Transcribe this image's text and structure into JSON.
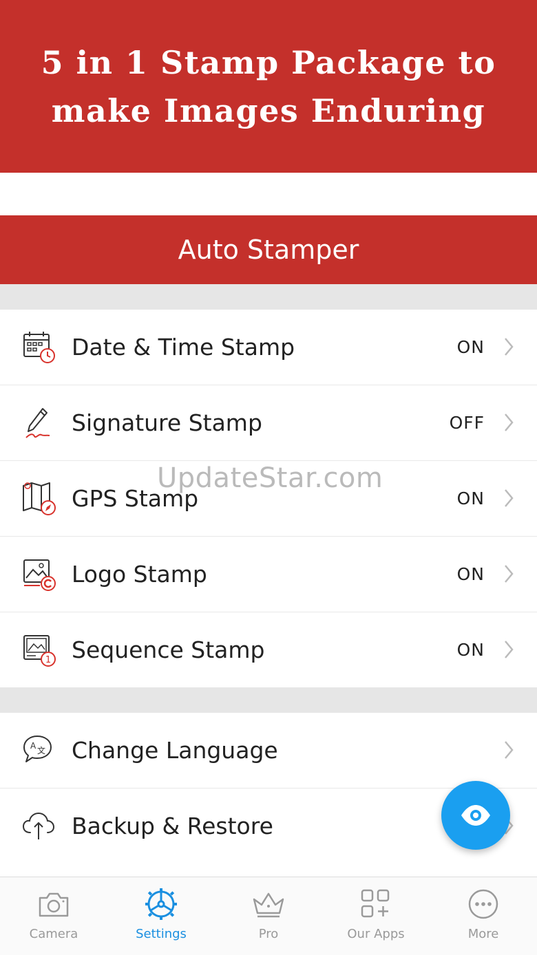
{
  "banner": {
    "line1": "5 in 1 Stamp Package to",
    "line2": "make Images Enduring"
  },
  "header": {
    "title": "Auto Stamper"
  },
  "stamps": [
    {
      "label": "Date & Time Stamp",
      "value": "ON",
      "icon": "calendar-clock-icon"
    },
    {
      "label": "Signature Stamp",
      "value": "OFF",
      "icon": "pen-signature-icon"
    },
    {
      "label": "GPS Stamp",
      "value": "ON",
      "icon": "map-compass-icon"
    },
    {
      "label": "Logo Stamp",
      "value": "ON",
      "icon": "image-copyright-icon"
    },
    {
      "label": "Sequence Stamp",
      "value": "ON",
      "icon": "image-number-icon"
    }
  ],
  "settings": [
    {
      "label": "Change Language",
      "icon": "translate-icon"
    },
    {
      "label": "Backup & Restore",
      "icon": "cloud-upload-icon"
    }
  ],
  "watermark": "UpdateStar.com",
  "fab": {
    "icon": "eye-icon"
  },
  "tabs": [
    {
      "label": "Camera",
      "icon": "camera-icon",
      "active": false
    },
    {
      "label": "Settings",
      "icon": "settings-wheel-icon",
      "active": true
    },
    {
      "label": "Pro",
      "icon": "crown-icon",
      "active": false
    },
    {
      "label": "Our Apps",
      "icon": "apps-grid-icon",
      "active": false
    },
    {
      "label": "More",
      "icon": "more-dots-icon",
      "active": false
    }
  ],
  "colors": {
    "brand_red": "#c4302b",
    "accent_blue": "#1a9ff0",
    "icon_red": "#d8322c"
  }
}
